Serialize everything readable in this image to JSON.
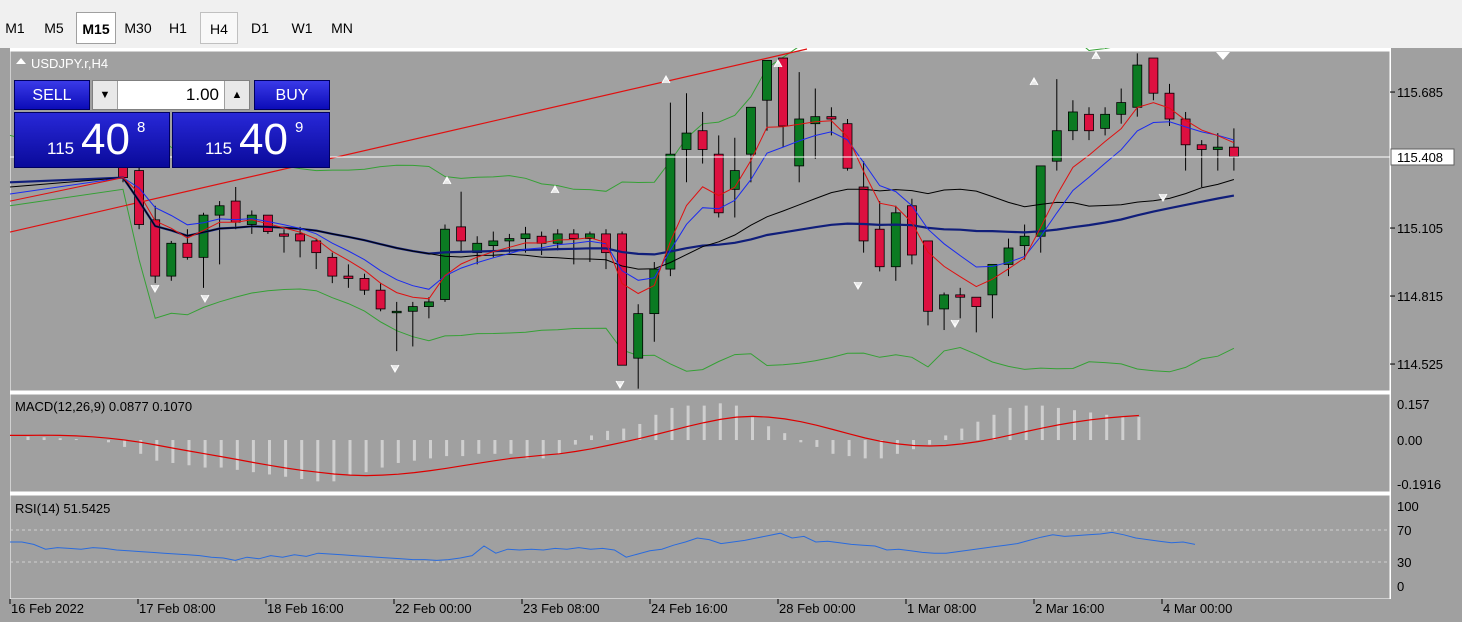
{
  "timeframes": [
    {
      "label": "M1",
      "state": "normal"
    },
    {
      "label": "M5",
      "state": "normal"
    },
    {
      "label": "M15",
      "state": "selected"
    },
    {
      "label": "M30",
      "state": "normal"
    },
    {
      "label": "H1",
      "state": "normal"
    },
    {
      "label": "H4",
      "state": "highlight"
    },
    {
      "label": "D1",
      "state": "normal"
    },
    {
      "label": "W1",
      "state": "normal"
    },
    {
      "label": "MN",
      "state": "normal"
    }
  ],
  "chart": {
    "symbol_label": "USDJPY.r,H4",
    "current_price_label": "115.408",
    "price_axis_labels": [
      "115.685",
      "115.105",
      "114.815",
      "114.525"
    ],
    "time_axis_labels": [
      "16 Feb 2022",
      "17 Feb 08:00",
      "18 Feb 16:00",
      "22 Feb 00:00",
      "23 Feb 08:00",
      "24 Feb 16:00",
      "28 Feb 00:00",
      "1 Mar 08:00",
      "2 Mar 16:00",
      "4 Mar 00:00"
    ],
    "colors": {
      "background": "#a0a0a0",
      "bull": "#0b7a22",
      "bear": "#dd1040",
      "ma_slow": "#101e7a",
      "ma_fast_red": "#e01010",
      "ma_fast_blue": "#1a2af0",
      "ma_mid_black": "#000000",
      "bollinger": "#35a035",
      "trendline": "#e01010",
      "macd_hist": "#cfcfcf",
      "macd_signal": "#dd0000",
      "rsi_line": "#2a6bdd",
      "current_price_line": "#ffffff"
    }
  },
  "trade_panel": {
    "sell_label": "SELL",
    "buy_label": "BUY",
    "lot_value": "1.00",
    "sell_price_prefix": "115",
    "sell_price_big": "40",
    "sell_price_sup": "8",
    "buy_price_prefix": "115",
    "buy_price_big": "40",
    "buy_price_sup": "9"
  },
  "macd": {
    "label": "MACD(12,26,9) 0.0877 0.1070",
    "axis_labels": [
      "0.157",
      "0.00",
      "-0.1916"
    ]
  },
  "rsi": {
    "label": "RSI(14) 51.5425",
    "axis_labels": [
      "100",
      "70",
      "30",
      "0"
    ]
  },
  "chart_data": {
    "type": "candlestick",
    "symbol": "USDJPY.r",
    "timeframe": "H4",
    "ohlc": [
      [
        115.45,
        115.46,
        115.3,
        115.32
      ],
      [
        115.35,
        115.4,
        115.1,
        115.12
      ],
      [
        115.14,
        115.2,
        114.87,
        114.9
      ],
      [
        114.9,
        115.05,
        114.88,
        115.04
      ],
      [
        115.04,
        115.1,
        114.97,
        114.98
      ],
      [
        114.98,
        115.17,
        114.85,
        115.16
      ],
      [
        115.16,
        115.22,
        114.95,
        115.2
      ],
      [
        115.22,
        115.28,
        115.1,
        115.13
      ],
      [
        115.12,
        115.18,
        115.08,
        115.16
      ],
      [
        115.16,
        115.16,
        115.08,
        115.09
      ],
      [
        115.08,
        115.1,
        115.0,
        115.07
      ],
      [
        115.08,
        115.11,
        114.98,
        115.05
      ],
      [
        115.05,
        115.06,
        114.93,
        115.0
      ],
      [
        114.98,
        115.0,
        114.87,
        114.9
      ],
      [
        114.9,
        114.95,
        114.85,
        114.89
      ],
      [
        114.89,
        114.91,
        114.82,
        114.84
      ],
      [
        114.84,
        114.87,
        114.75,
        114.76
      ],
      [
        114.75,
        114.79,
        114.58,
        114.75
      ],
      [
        114.75,
        114.79,
        114.6,
        114.77
      ],
      [
        114.77,
        114.81,
        114.72,
        114.79
      ],
      [
        114.8,
        115.12,
        114.79,
        115.1
      ],
      [
        115.11,
        115.26,
        115.0,
        115.05
      ],
      [
        115.0,
        115.07,
        114.95,
        115.04
      ],
      [
        115.03,
        115.09,
        114.98,
        115.05
      ],
      [
        115.05,
        115.08,
        115.0,
        115.06
      ],
      [
        115.06,
        115.11,
        115.0,
        115.08
      ],
      [
        115.07,
        115.09,
        114.99,
        115.04
      ],
      [
        115.04,
        115.1,
        115.01,
        115.08
      ],
      [
        115.08,
        115.1,
        114.95,
        115.06
      ],
      [
        115.06,
        115.09,
        114.96,
        115.08
      ],
      [
        115.08,
        115.1,
        114.93,
        115.0
      ],
      [
        115.08,
        115.09,
        114.7,
        114.52
      ],
      [
        114.55,
        114.78,
        114.42,
        114.74
      ],
      [
        114.74,
        114.96,
        114.62,
        114.93
      ],
      [
        114.93,
        115.64,
        114.9,
        115.42
      ],
      [
        115.44,
        115.68,
        115.3,
        115.51
      ],
      [
        115.52,
        115.6,
        115.38,
        115.44
      ],
      [
        115.42,
        115.5,
        115.15,
        115.17
      ],
      [
        115.27,
        115.49,
        115.15,
        115.35
      ],
      [
        115.42,
        115.58,
        115.3,
        115.62
      ],
      [
        115.65,
        115.8,
        115.52,
        115.82
      ],
      [
        115.83,
        115.8,
        115.45,
        115.54
      ],
      [
        115.37,
        115.77,
        115.3,
        115.57
      ],
      [
        115.55,
        115.7,
        115.4,
        115.58
      ],
      [
        115.58,
        115.62,
        115.5,
        115.57
      ],
      [
        115.55,
        115.57,
        115.35,
        115.36
      ],
      [
        115.28,
        115.39,
        115.0,
        115.05
      ],
      [
        115.1,
        115.22,
        114.92,
        114.94
      ],
      [
        114.94,
        115.2,
        114.88,
        115.17
      ],
      [
        115.2,
        115.23,
        114.95,
        114.99
      ],
      [
        115.05,
        115.05,
        114.69,
        114.75
      ],
      [
        114.76,
        114.83,
        114.67,
        114.82
      ],
      [
        114.82,
        114.85,
        114.72,
        114.81
      ],
      [
        114.81,
        114.8,
        114.66,
        114.77
      ],
      [
        114.82,
        114.95,
        114.72,
        114.95
      ],
      [
        114.95,
        115.06,
        114.9,
        115.02
      ],
      [
        115.03,
        115.12,
        114.97,
        115.07
      ],
      [
        115.07,
        115.35,
        115.0,
        115.37
      ],
      [
        115.39,
        115.74,
        115.35,
        115.52
      ],
      [
        115.52,
        115.65,
        115.48,
        115.6
      ],
      [
        115.59,
        115.62,
        115.48,
        115.52
      ],
      [
        115.53,
        115.62,
        115.5,
        115.59
      ],
      [
        115.59,
        115.7,
        115.55,
        115.64
      ],
      [
        115.62,
        115.85,
        115.58,
        115.8
      ],
      [
        115.83,
        115.82,
        115.65,
        115.68
      ],
      [
        115.68,
        115.72,
        115.54,
        115.57
      ],
      [
        115.57,
        115.6,
        115.35,
        115.46
      ],
      [
        115.46,
        115.48,
        115.28,
        115.44
      ],
      [
        115.44,
        115.51,
        115.35,
        115.45
      ],
      [
        115.45,
        115.53,
        115.35,
        115.41
      ]
    ],
    "current_price": 115.408,
    "price_range": [
      114.41,
      115.86
    ],
    "price_ticks": [
      115.685,
      115.105,
      114.815,
      114.525
    ],
    "time_labels": [
      "16 Feb 2022",
      "17 Feb 08:00",
      "18 Feb 16:00",
      "22 Feb 00:00",
      "23 Feb 08:00",
      "24 Feb 16:00",
      "28 Feb 00:00",
      "1 Mar 08:00",
      "2 Mar 16:00",
      "4 Mar 00:00"
    ],
    "macd": {
      "params": "12,26,9",
      "main": 0.0877,
      "signal": 0.107,
      "ylim": [
        -0.1916,
        0.157
      ],
      "hist": [
        0.015,
        0.012,
        0.008,
        0.004,
        0.0,
        -0.01,
        -0.03,
        -0.06,
        -0.09,
        -0.1,
        -0.11,
        -0.12,
        -0.12,
        -0.13,
        -0.14,
        -0.15,
        -0.16,
        -0.17,
        -0.18,
        -0.18,
        -0.15,
        -0.14,
        -0.12,
        -0.1,
        -0.09,
        -0.08,
        -0.07,
        -0.07,
        -0.06,
        -0.06,
        -0.06,
        -0.08,
        -0.08,
        -0.06,
        -0.02,
        0.02,
        0.04,
        0.05,
        0.07,
        0.11,
        0.14,
        0.15,
        0.15,
        0.16,
        0.15,
        0.1,
        0.06,
        0.03,
        -0.01,
        -0.03,
        -0.06,
        -0.07,
        -0.08,
        -0.08,
        -0.06,
        -0.04,
        -0.02,
        0.02,
        0.05,
        0.08,
        0.11,
        0.14,
        0.15,
        0.15,
        0.14,
        0.13,
        0.12,
        0.11,
        0.1,
        0.1
      ],
      "signal_line": [
        0.02,
        0.021,
        0.02,
        0.018,
        0.014,
        0.008,
        0.0,
        -0.01,
        -0.022,
        -0.035,
        -0.048,
        -0.06,
        -0.072,
        -0.085,
        -0.098,
        -0.11,
        -0.122,
        -0.132,
        -0.14,
        -0.148,
        -0.153,
        -0.155,
        -0.153,
        -0.149,
        -0.142,
        -0.133,
        -0.123,
        -0.112,
        -0.101,
        -0.09,
        -0.08,
        -0.073,
        -0.066,
        -0.06,
        -0.05,
        -0.038,
        -0.024,
        -0.009,
        0.007,
        0.024,
        0.042,
        0.06,
        0.076,
        0.09,
        0.1,
        0.103,
        0.1,
        0.092,
        0.08,
        0.064,
        0.046,
        0.027,
        0.009,
        -0.006,
        -0.017,
        -0.024,
        -0.026,
        -0.024,
        -0.017,
        -0.007,
        0.006,
        0.021,
        0.037,
        0.052,
        0.066,
        0.078,
        0.088,
        0.096,
        0.102,
        0.107
      ]
    },
    "rsi": {
      "params": "14",
      "value": 51.5425,
      "levels": [
        70,
        30
      ],
      "ylim": [
        0,
        100
      ],
      "values": [
        55,
        55,
        52,
        46,
        48,
        47,
        46,
        48,
        47,
        45,
        44,
        43,
        42,
        41,
        40,
        39,
        38,
        36,
        35,
        32,
        36,
        34,
        38,
        36,
        39,
        37,
        41,
        40,
        39,
        38,
        37,
        36,
        35,
        34,
        33,
        33,
        32,
        33,
        35,
        38,
        50,
        41,
        46,
        45,
        46,
        45,
        47,
        46,
        48,
        46,
        47,
        45,
        36,
        40,
        44,
        46,
        51,
        55,
        60,
        58,
        53,
        55,
        57,
        60,
        63,
        66,
        60,
        62,
        55,
        56,
        54,
        52,
        51,
        50,
        45,
        46,
        44,
        42,
        41,
        41,
        43,
        45,
        47,
        49,
        51,
        53,
        57,
        61,
        64,
        62,
        63,
        64,
        65,
        67,
        64,
        60,
        58,
        56,
        54,
        55,
        52
      ],
      "values_note": "sampled"
    }
  }
}
